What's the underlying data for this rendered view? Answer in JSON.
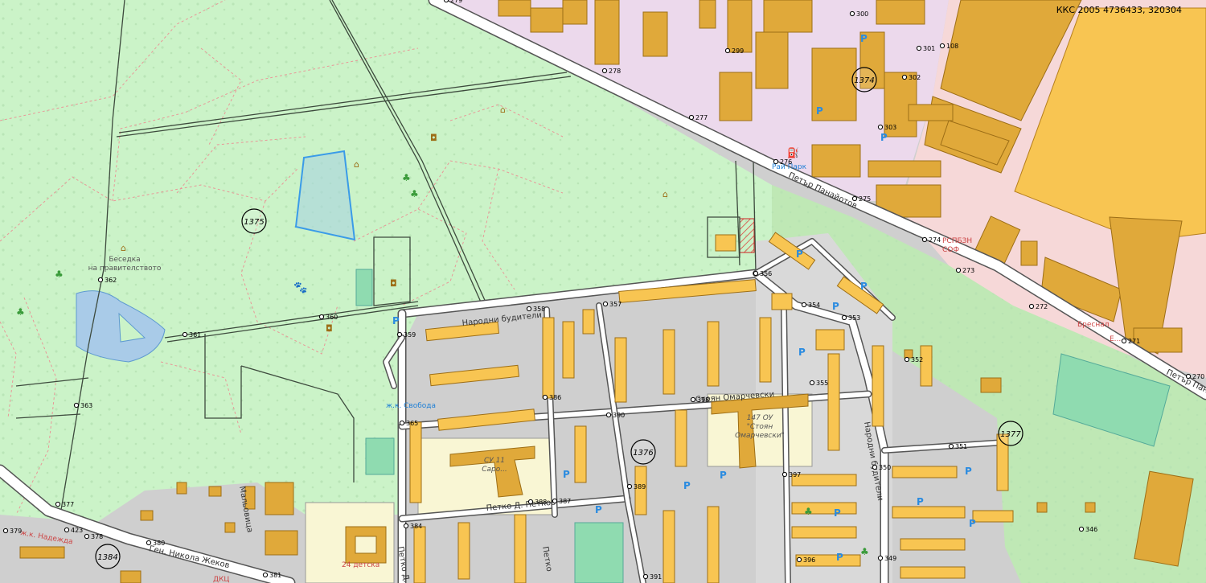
{
  "coordinate_readout": "ККС 2005 4736433, 320304",
  "cadastral_districts": [
    "1374",
    "1375",
    "1376",
    "1377",
    "1384"
  ],
  "streets": [
    "Петър Панайотов",
    "Петър Панайотов",
    "Народни будители",
    "Стоян Омарчевски",
    "Петко Д. Петков",
    "Народни будители",
    "Ген. Никола Жеков",
    "Петко Д...",
    "Петко",
    "Мальовица"
  ],
  "places": [
    "Беседка\nна правителството",
    "Рай Парк",
    "ж.к. Свобода",
    "147 ОУ\n\"Стоян\nОмарчевски\"",
    "СУ 11\nСаро...",
    "РСПБЗН\nСОФ",
    "ж.к. Надежда",
    "24 детска",
    "ДКЦ",
    "Бреснал",
    "Е..."
  ],
  "points": [
    "279",
    "300",
    "108",
    "301",
    "302",
    "303",
    "299",
    "278",
    "277",
    "276",
    "275",
    "274",
    "273",
    "272",
    "271",
    "270",
    "362",
    "361",
    "360",
    "363",
    "359",
    "358",
    "357",
    "356",
    "354",
    "353",
    "352",
    "355",
    "386",
    "365",
    "390",
    "398",
    "397",
    "351",
    "350",
    "389",
    "388",
    "387",
    "384",
    "391",
    "396",
    "349",
    "346",
    "377",
    "379",
    "423",
    "378",
    "380",
    "381"
  ],
  "colors": {
    "park_green": "#cbf3c8",
    "industrial_lilac": "#ecd9ec",
    "commercial_pink": "#f6d8d8",
    "building_orange": "#e0a93a",
    "building_yellow": "#f8c552",
    "school_cream": "#f9f6d4",
    "water_blue": "#a9cbe8",
    "road_white": "#ffffff",
    "parcel_line": "#e89898",
    "label_blue": "#1e7fd6"
  },
  "icons": [
    "parking-icon",
    "paw-icon",
    "picnic-icon",
    "tree-icon",
    "fuel-station-icon",
    "monument-icon"
  ]
}
